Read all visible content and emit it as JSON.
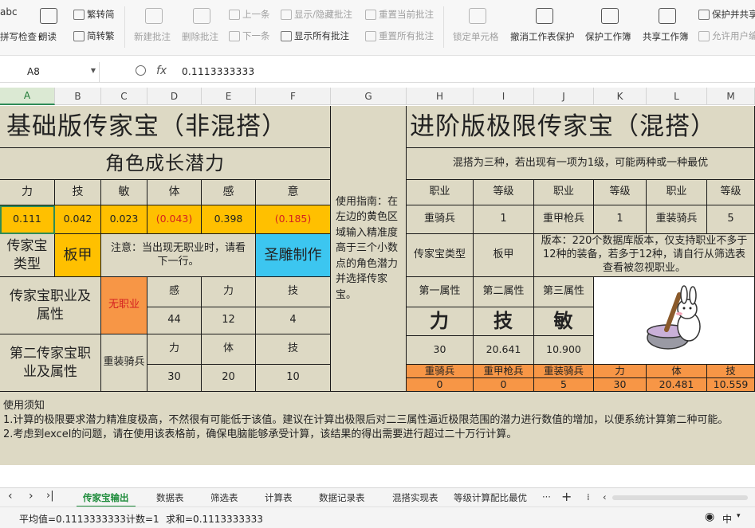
{
  "ribbon": {
    "spell": "abc",
    "spell_check": "拼写检查",
    "read_aloud": "朗读",
    "trad": "繁转简",
    "simp": "简转繁",
    "new_comment": "新建批注",
    "del_comment": "删除批注",
    "prev": "上一条",
    "next": "下一条",
    "show_hide": "显示/隐藏批注",
    "show_all": "显示所有批注",
    "reset_current": "重置当前批注",
    "reset_all": "重置所有批注",
    "lock_cell": "锁定单元格",
    "unprotect_sheet": "撤消工作表保护",
    "protect_book": "保护工作簿",
    "share_book": "共享工作簿",
    "protect_share": "保护并共享",
    "allow_edit": "允许用户编"
  },
  "formula_bar": {
    "name": "A8",
    "fx": "fx",
    "value": "0.1113333333"
  },
  "columns": [
    "A",
    "B",
    "C",
    "D",
    "E",
    "F",
    "G",
    "H",
    "I",
    "J",
    "K",
    "L",
    "M"
  ],
  "left": {
    "title": "基础版传家宝（非混搭）",
    "growth": "角色成长潜力",
    "stats": [
      "力",
      "技",
      "敏",
      "体",
      "感",
      "意"
    ],
    "values": [
      "0.111",
      "0.042",
      "0.023",
      "(0.043)",
      "0.398",
      "(0.185)"
    ],
    "type_label": "传家宝类型",
    "type_value": "板甲",
    "notice": "注意：当出现无职业时，请看下一行。",
    "craft": "圣雕制作",
    "job_label": "传家宝职业及属性",
    "job_value": "无职业",
    "job_attr": [
      "感",
      "力",
      "技"
    ],
    "job_num": [
      "44",
      "12",
      "4"
    ],
    "job2_label": "第二传家宝职业及属性",
    "job2_value": "重装骑兵",
    "job2_attr": [
      "力",
      "体",
      "技"
    ],
    "job2_num": [
      "30",
      "20",
      "10"
    ]
  },
  "guide": "使用指南：在左边的黄色区域输入精准度高于三个小数点的角色潜力并选择传家宝。",
  "right": {
    "title": "进阶版极限传家宝（混搭）",
    "mix_note": "混搭为三种，若出现有一项为1级，可能两种或一种最优",
    "headers": [
      "职业",
      "等级",
      "职业",
      "等级",
      "职业",
      "等级"
    ],
    "row": [
      "重骑兵",
      "1",
      "重甲枪兵",
      "1",
      "重装骑兵",
      "5"
    ],
    "version": "版本：220个数据库版本，仅支持职业不多于12种的装备，若多于12种，请自行从筛选表查看被忽视职业。",
    "type_label": "传家宝类型",
    "type_value": "板甲",
    "attr_headers": [
      "第一属性",
      "第二属性",
      "第三属性"
    ],
    "attrs": [
      "力",
      "技",
      "敏"
    ],
    "attr_values": [
      "30",
      "20.641",
      "10.900"
    ],
    "bottom_labels": [
      "重骑兵",
      "重甲枪兵",
      "重装骑兵",
      "力",
      "体",
      "技"
    ],
    "bottom_values": [
      "0",
      "0",
      "5",
      "30",
      "20.481",
      "10.559"
    ]
  },
  "notes": {
    "title": "使用须知",
    "line1": "1.计算的极限要求潜力精准度极高，不然很有可能低于该值。建议在计算出极限后对二三属性逼近极限范围的潜力进行数值的增加，以便系统计算第二种可能。",
    "line2": "2.考虑到excel的问题，请在使用该表格前，确保电脑能够承受计算，该结果的得出需要进行超过二十万行计算。"
  },
  "sheets": [
    "传家宝输出",
    "数据表",
    "筛选表",
    "计算表",
    "数据记录表",
    "混搭实现表",
    "等级计算配比最优"
  ],
  "status": {
    "avg": "平均值=0.1113333333",
    "count": "计数=1",
    "sum": "求和=0.1113333333",
    "view": "中"
  }
}
